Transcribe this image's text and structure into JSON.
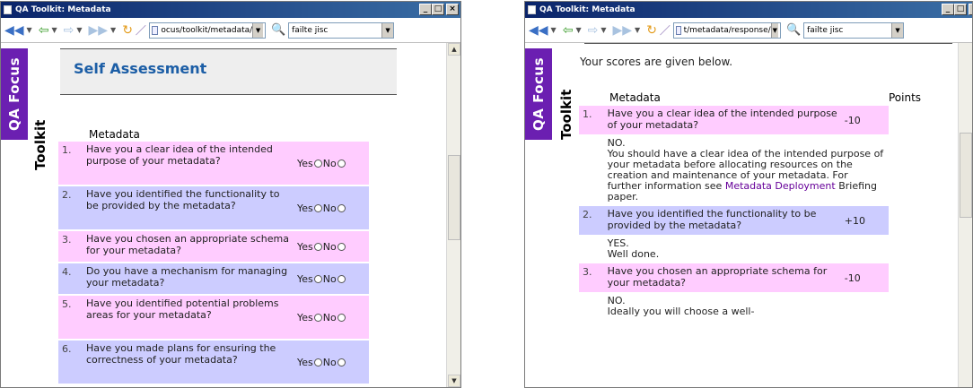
{
  "windows": [
    {
      "title": "QA Toolkit: Metadata",
      "address": "ocus/toolkit/metadata/",
      "search": "failte jisc"
    },
    {
      "title": "QA Toolkit: Metadata",
      "address": "t/metadata/response/",
      "search": "failte jisc"
    }
  ],
  "brand": {
    "qa_focus": "QA Focus",
    "toolkit": "Toolkit"
  },
  "left": {
    "heading": "Self Assessment",
    "section": "Metadata",
    "yes_label": "Yes",
    "no_label": "No",
    "questions": [
      {
        "num": "1.",
        "text": "Have you a clear idea of the intended purpose of your metadata?"
      },
      {
        "num": "2.",
        "text": "Have you identified the functionality to be provided by the metadata?"
      },
      {
        "num": "3.",
        "text": "Have you chosen an appropriate schema for your metadata?"
      },
      {
        "num": "4.",
        "text": "Do you have a mechanism for managing your metadata?"
      },
      {
        "num": "5.",
        "text": "Have you identified potential problems areas for your metadata?"
      },
      {
        "num": "6.",
        "text": "Have you made plans for ensuring the correctness of your metadata?"
      }
    ]
  },
  "right": {
    "intro": "Your scores are given below.",
    "col_section": "Metadata",
    "col_points": "Points",
    "items": [
      {
        "num": "1.",
        "text": "Have you a clear idea of the intended purpose of your metadata?",
        "points": "-10",
        "answer": "NO.",
        "feedback_before": "You should have a clear idea of the intended purpose of your metadata before allocating resources on the creation and maintenance of your metadata. For further information see",
        "link": "Metadata Deployment",
        "feedback_after": "Briefing paper."
      },
      {
        "num": "2.",
        "text": "Have you identified the functionality to be provided by the metadata?",
        "points": "+10",
        "answer": "YES.",
        "feedback_before": "Well done."
      },
      {
        "num": "3.",
        "text": "Have you chosen an appropriate schema for your metadata?",
        "points": "-10",
        "answer": "NO.",
        "feedback_before": "Ideally you will choose a well-"
      }
    ]
  },
  "colors": {
    "title_bar": "#0a246a",
    "qa_focus_bg": "#6b1fb1",
    "heading": "#1c5ea6",
    "row_pink": "#ffccff",
    "row_lavender": "#ccccff",
    "link": "#660099"
  }
}
